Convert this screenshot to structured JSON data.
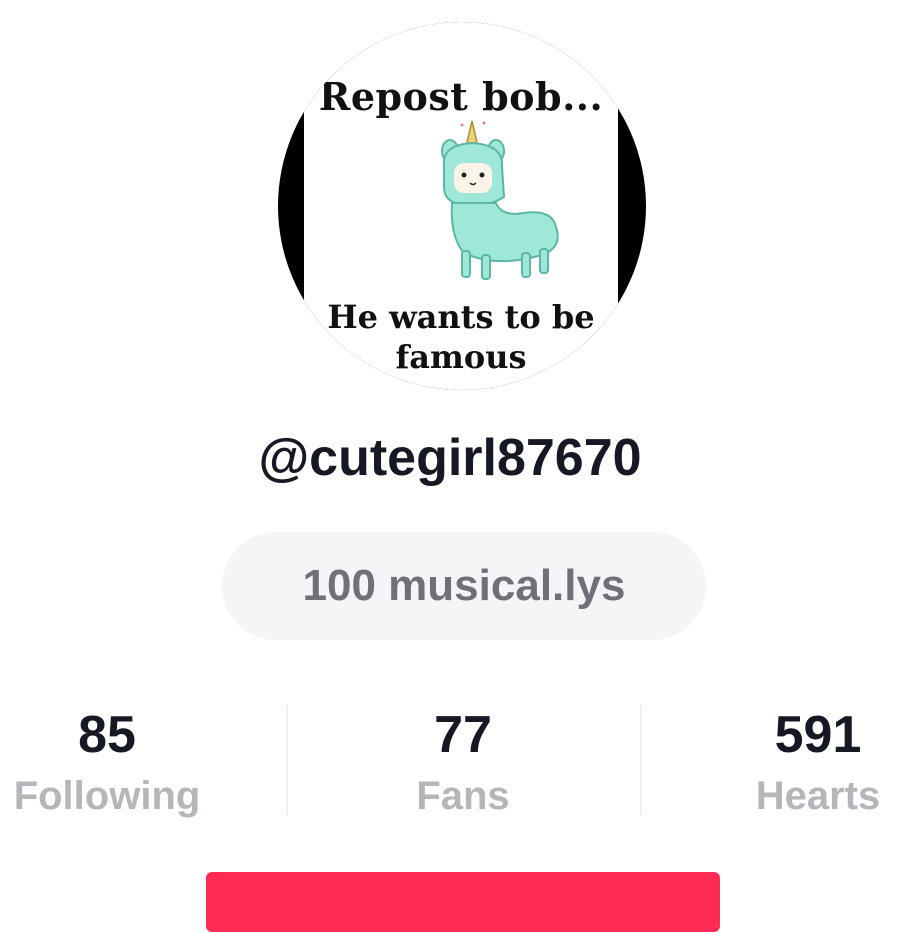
{
  "profile": {
    "avatar_text_top": "Repost bob...",
    "avatar_text_bottom": "He wants to be famous",
    "username": "@cutegirl87670",
    "badge": "100 musical.lys"
  },
  "stats": [
    {
      "value": "85",
      "label": "Following"
    },
    {
      "value": "77",
      "label": "Fans"
    },
    {
      "value": "591",
      "label": "Hearts"
    }
  ],
  "colors": {
    "accent": "#fe2c55",
    "text_primary": "#161823",
    "text_muted": "#b5b6ba",
    "badge_bg": "#f5f5f7"
  }
}
